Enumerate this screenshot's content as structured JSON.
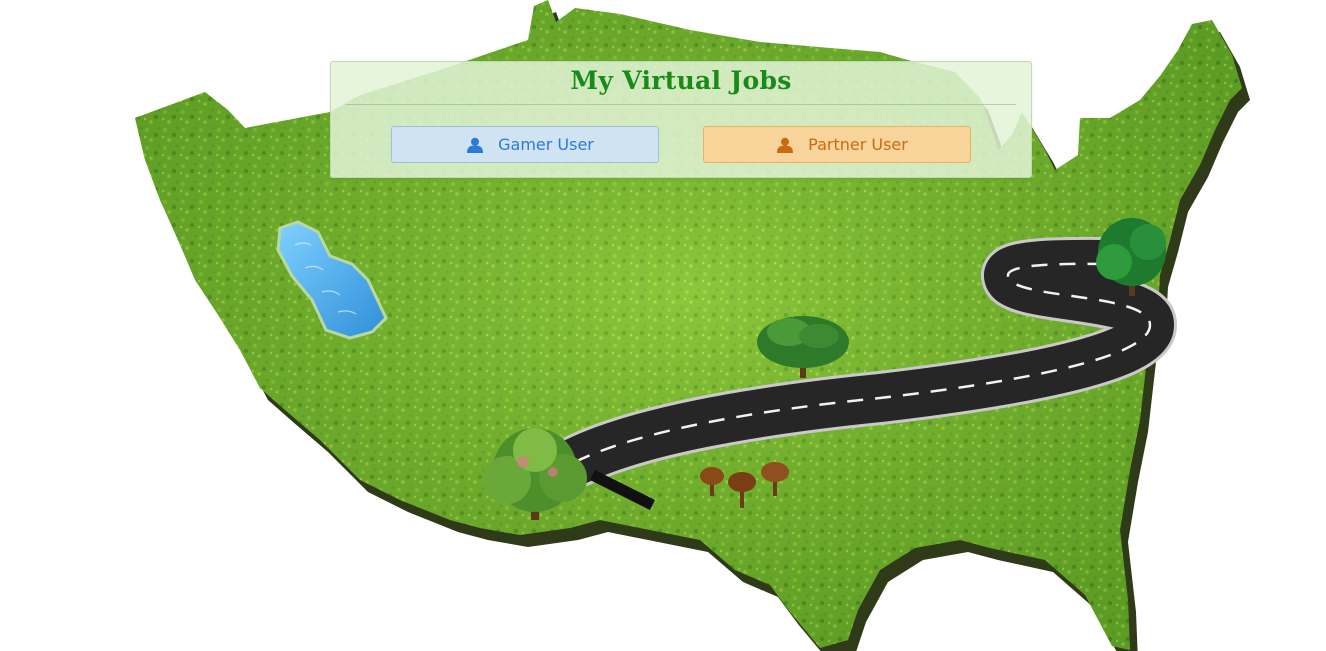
{
  "header": {
    "title": "My Virtual Jobs"
  },
  "roles": [
    {
      "label": "Gamer User",
      "icon": "user-icon",
      "color": "#2a7bd6"
    },
    {
      "label": "Partner User",
      "icon": "user-icon",
      "color": "#c96b12"
    }
  ],
  "colors": {
    "title": "#1a8a1a",
    "grass": "#6fb52c",
    "water": "#4aa8e8",
    "road": "#262626"
  }
}
